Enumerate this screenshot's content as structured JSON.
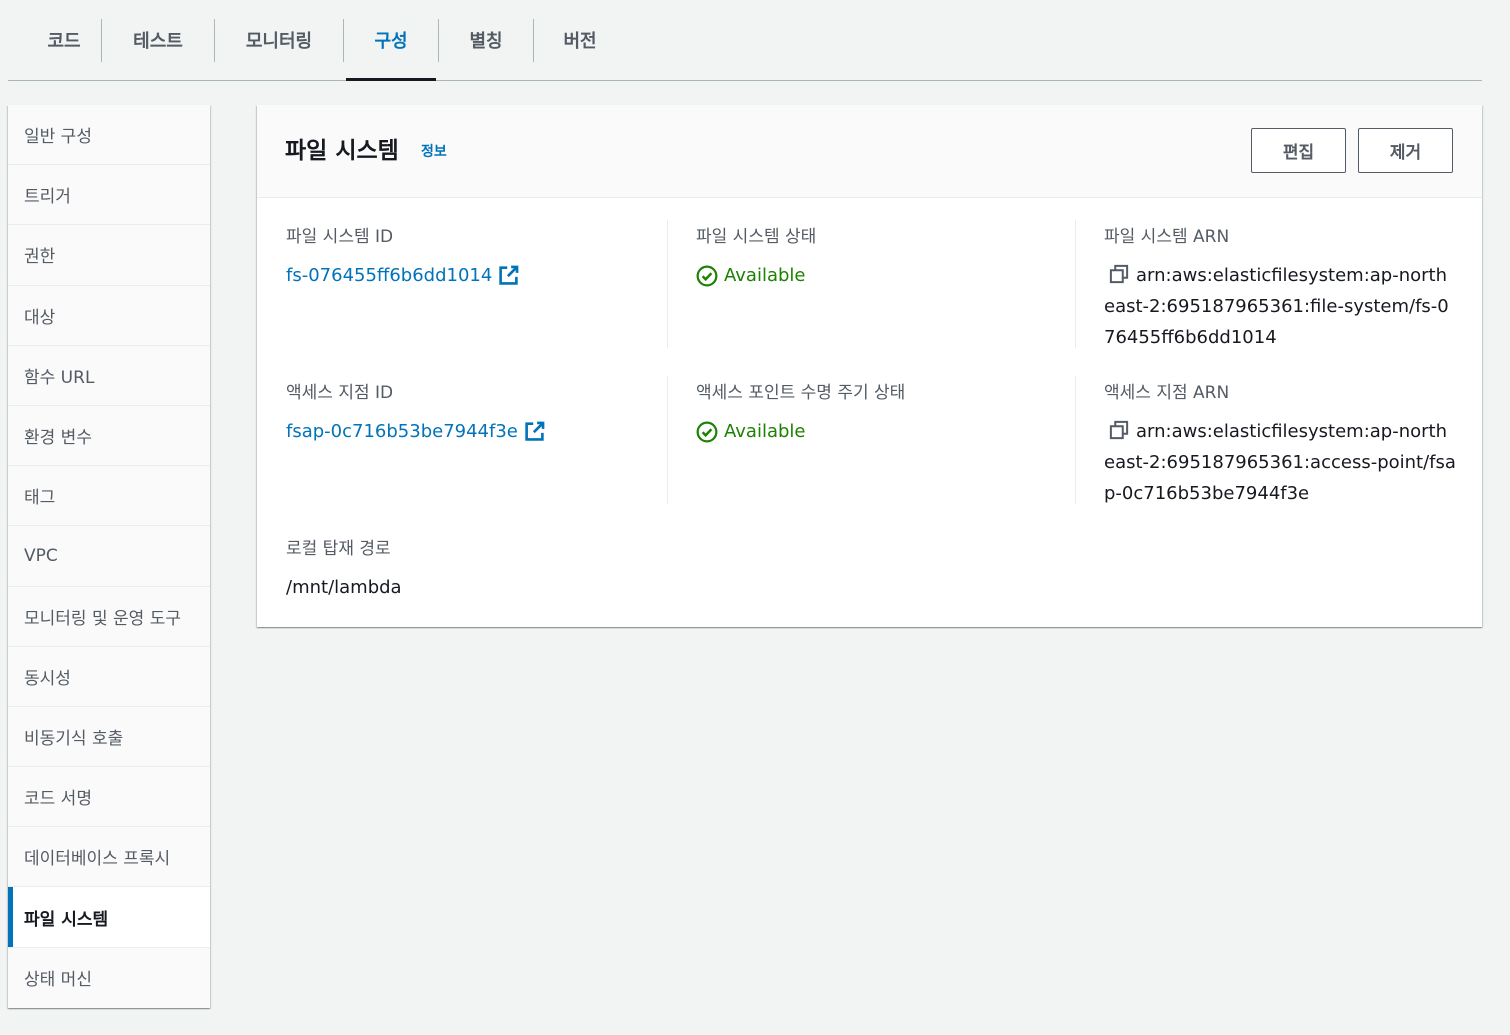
{
  "tabs": [
    {
      "label": "코드"
    },
    {
      "label": "테스트"
    },
    {
      "label": "모니터링"
    },
    {
      "label": "구성",
      "active": true
    },
    {
      "label": "별칭"
    },
    {
      "label": "버전"
    }
  ],
  "subnav": {
    "items": [
      {
        "label": "일반 구성"
      },
      {
        "label": "트리거"
      },
      {
        "label": "권한"
      },
      {
        "label": "대상"
      },
      {
        "label": "함수 URL"
      },
      {
        "label": "환경 변수"
      },
      {
        "label": "태그"
      },
      {
        "label": "VPC"
      },
      {
        "label": "모니터링 및 운영 도구"
      },
      {
        "label": "동시성"
      },
      {
        "label": "비동기식 호출"
      },
      {
        "label": "코드 서명"
      },
      {
        "label": "데이터베이스 프록시"
      },
      {
        "label": "파일 시스템",
        "active": true
      },
      {
        "label": "상태 머신"
      }
    ]
  },
  "panel": {
    "title": "파일 시스템",
    "info_link": "정보",
    "edit_button": "편집",
    "remove_button": "제거",
    "fields": {
      "fs_id_label": "파일 시스템 ID",
      "fs_id_value": "fs-076455ff6b6dd1014",
      "fs_state_label": "파일 시스템 상태",
      "fs_state_value": "Available",
      "fs_arn_label": "파일 시스템 ARN",
      "fs_arn_value": "arn:aws:elasticfilesystem:ap-northeast-2:695187965361:file-system/fs-076455ff6b6dd1014",
      "ap_id_label": "액세스 지점 ID",
      "ap_id_value": "fsap-0c716b53be7944f3e",
      "ap_lifecycle_label": "액세스 포인트 수명 주기 상태",
      "ap_lifecycle_value": "Available",
      "ap_arn_label": "액세스 지점 ARN",
      "ap_arn_value": "arn:aws:elasticfilesystem:ap-northeast-2:695187965361:access-point/fsap-0c716b53be7944f3e",
      "mount_path_label": "로컬 탑재 경로",
      "mount_path_value": "/mnt/lambda"
    }
  },
  "icons": {
    "external_link": "external-link-icon",
    "status_ok": "check-circle-icon",
    "copy": "copy-icon"
  },
  "colors": {
    "link": "#0073bb",
    "success": "#1d8102",
    "active_indicator": "#0073bb",
    "background": "#f2f3f3"
  }
}
